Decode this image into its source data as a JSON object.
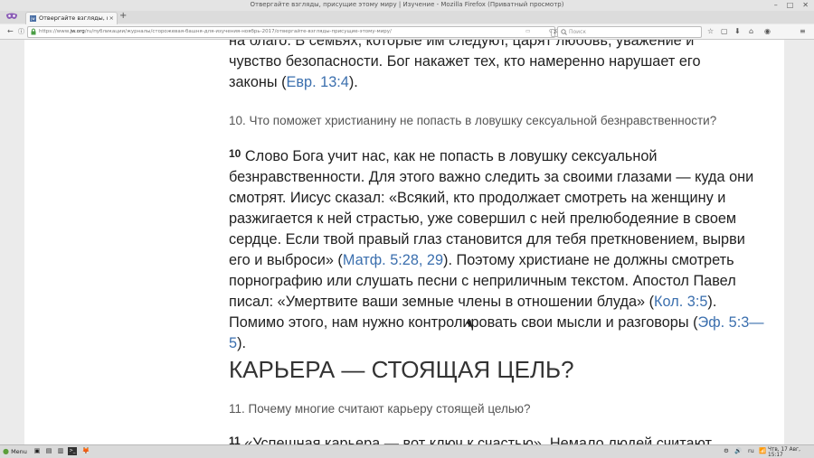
{
  "window": {
    "title": "Отвергайте взгляды, присущие этому миру | Изучение - Mozilla Firefox (Приватный просмотр)",
    "controls": {
      "minimize": "–",
      "maximize": "□",
      "close": "✕"
    }
  },
  "tabs": [
    {
      "favicon": "jw",
      "label": "Отвергайте взгляды, при",
      "close": "×"
    }
  ],
  "newtab": "+",
  "nav": {
    "back": "←",
    "info": "ⓘ",
    "lock": "🔒",
    "url_prefix": "https://www.",
    "url_domain": "jw.org",
    "url_rest": "/ru/публикации/журналы/сторожевая-башня-для-изучения-ноябрь-2017/отвергайте-взгляды-присущие-этому-миру/",
    "reader": "▭",
    "zoom": "240%",
    "reload": "C",
    "search_placeholder": "Поиск",
    "icons": [
      "☆",
      "▢",
      "⬇",
      "⌂",
      "◉",
      "≡"
    ]
  },
  "article": {
    "p9_tail": "на благо. В семьях, которые им следуют, царят любовь, уважение и чувство безопасности. Бог накажет тех, кто намеренно нарушает его законы (",
    "p9_ref": "Евр. 13:4",
    "p9_end": ").",
    "q10": "10. Что поможет христианину не попасть в ловушку сексуальной безнравственности?",
    "p10_num": "10",
    "p10_a": "Слово Бога учит нас, как не попасть в ловушку сексуальной безнравственности. Для этого важно следить за своими глазами — куда они смотрят. Иисус сказал: «Всякий, кто продолжает смотреть на женщину и разжигается к ней страстью, уже совершил с ней прелюбодеяние в своем сердце. Если твой правый глаз становится для тебя преткновением, вырви его и выброси» (",
    "p10_ref1": "Матф. 5:28, 29",
    "p10_b": "). Поэтому христиане не должны смотреть порнографию или слушать песни с неприличным текстом. Апостол Павел писал: «Умертвите ваши земные члены в отношении блуда» (",
    "p10_ref2": "Кол. 3:5",
    "p10_c": "). Помимо этого, нам нужно контролировать свои мысли и разговоры (",
    "p10_ref3": "Эф. 5:3—5",
    "p10_d": ").",
    "heading": "КАРЬЕРА — СТОЯЩАЯ ЦЕЛЬ?",
    "q11": "11. Почему многие считают карьеру стоящей целью?",
    "p11_num": "11",
    "p11_a": "«Успешная карьера — вот ключ к счастью». Немало людей считают карьеру"
  },
  "taskbar": {
    "menu": "Menu",
    "apps": [
      "▣",
      "▤",
      "▥",
      ">_",
      "🦊"
    ],
    "tray": [
      "⚙",
      "🔊",
      "ru",
      "📶"
    ],
    "clock": "Чтв, 17 Авг, 15:17"
  }
}
